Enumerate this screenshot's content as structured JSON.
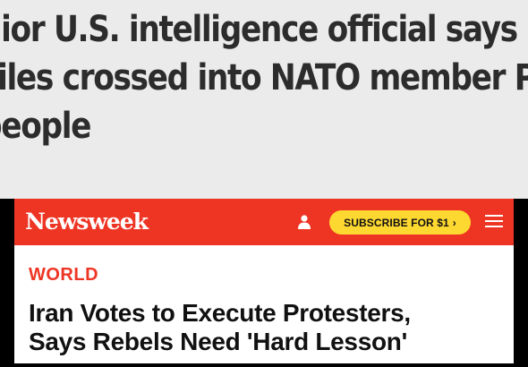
{
  "top_headline": {
    "lines": [
      "nior U.S. intelligence official says Russian",
      "siles crossed into NATO member Poland, k",
      "people"
    ]
  },
  "newsweek": {
    "logo": "Newsweek",
    "subscribe_label": "SUBSCRIBE FOR $1",
    "subscribe_chevron": "›",
    "icons": [
      "user-icon",
      "menu-icon"
    ],
    "section": "WORLD",
    "title_lines": [
      "Iran Votes to Execute Protesters,",
      "Says Rebels Need 'Hard Lesson'"
    ],
    "colors": {
      "brand_red": "#ee3524",
      "subscribe_yellow": "#fdd831"
    }
  }
}
